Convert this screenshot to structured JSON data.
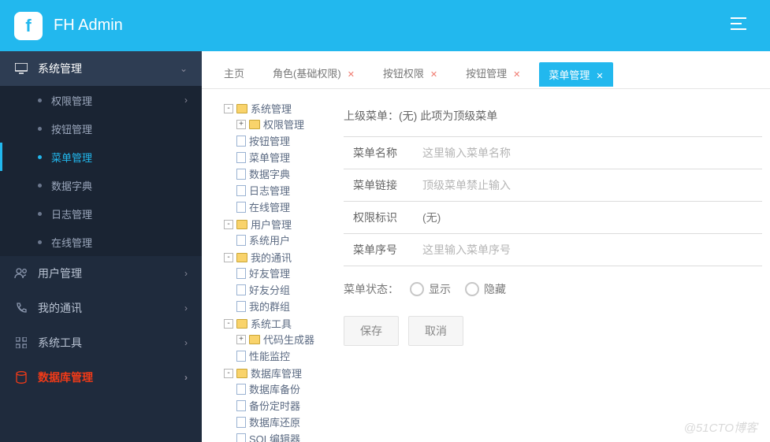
{
  "header": {
    "brand": "FH Admin"
  },
  "sidebar": {
    "items": [
      {
        "label": "系统管理",
        "icon": "monitor",
        "expanded": true,
        "children": [
          {
            "label": "权限管理"
          },
          {
            "label": "按钮管理"
          },
          {
            "label": "菜单管理",
            "active": true
          },
          {
            "label": "数据字典"
          },
          {
            "label": "日志管理"
          },
          {
            "label": "在线管理"
          }
        ]
      },
      {
        "label": "用户管理",
        "icon": "users"
      },
      {
        "label": "我的通讯",
        "icon": "phone"
      },
      {
        "label": "系统工具",
        "icon": "grid"
      },
      {
        "label": "数据库管理",
        "icon": "database",
        "red": true
      }
    ]
  },
  "tabs": [
    {
      "label": "主页",
      "closable": false
    },
    {
      "label": "角色(基础权限)",
      "closable": true
    },
    {
      "label": "按钮权限",
      "closable": true
    },
    {
      "label": "按钮管理",
      "closable": true
    },
    {
      "label": "菜单管理",
      "closable": true,
      "active": true
    }
  ],
  "tree": [
    {
      "label": "系统管理",
      "type": "folder",
      "open": true,
      "children": [
        {
          "label": "权限管理",
          "type": "folder",
          "open": false,
          "plus": true
        },
        {
          "label": "按钮管理",
          "type": "file"
        },
        {
          "label": "菜单管理",
          "type": "file"
        },
        {
          "label": "数据字典",
          "type": "file"
        },
        {
          "label": "日志管理",
          "type": "file"
        },
        {
          "label": "在线管理",
          "type": "file"
        }
      ]
    },
    {
      "label": "用户管理",
      "type": "folder",
      "open": true,
      "children": [
        {
          "label": "系统用户",
          "type": "file"
        }
      ]
    },
    {
      "label": "我的通讯",
      "type": "folder",
      "open": true,
      "children": [
        {
          "label": "好友管理",
          "type": "file"
        },
        {
          "label": "好友分组",
          "type": "file"
        },
        {
          "label": "我的群组",
          "type": "file"
        }
      ]
    },
    {
      "label": "系统工具",
      "type": "folder",
      "open": true,
      "children": [
        {
          "label": "代码生成器",
          "type": "folder",
          "open": false,
          "plus": true
        },
        {
          "label": "性能监控",
          "type": "file"
        }
      ]
    },
    {
      "label": "数据库管理",
      "type": "folder",
      "open": true,
      "children": [
        {
          "label": "数据库备份",
          "type": "file"
        },
        {
          "label": "备份定时器",
          "type": "file"
        },
        {
          "label": "数据库还原",
          "type": "file"
        },
        {
          "label": "SQL编辑器",
          "type": "file"
        }
      ]
    }
  ],
  "form": {
    "parent_label": "上级菜单：",
    "parent_value": "(无) 此项为顶级菜单",
    "fields": {
      "name": {
        "label": "菜单名称",
        "placeholder": "这里输入菜单名称",
        "value": ""
      },
      "link": {
        "label": "菜单链接",
        "placeholder": "顶级菜单禁止输入",
        "value": ""
      },
      "perm": {
        "label": "权限标识",
        "static": "(无)"
      },
      "order": {
        "label": "菜单序号",
        "placeholder": "这里输入菜单序号",
        "value": ""
      }
    },
    "status": {
      "label": "菜单状态：",
      "options": [
        "显示",
        "隐藏"
      ]
    },
    "buttons": {
      "save": "保存",
      "cancel": "取消"
    }
  },
  "watermark": "@51CTO博客"
}
